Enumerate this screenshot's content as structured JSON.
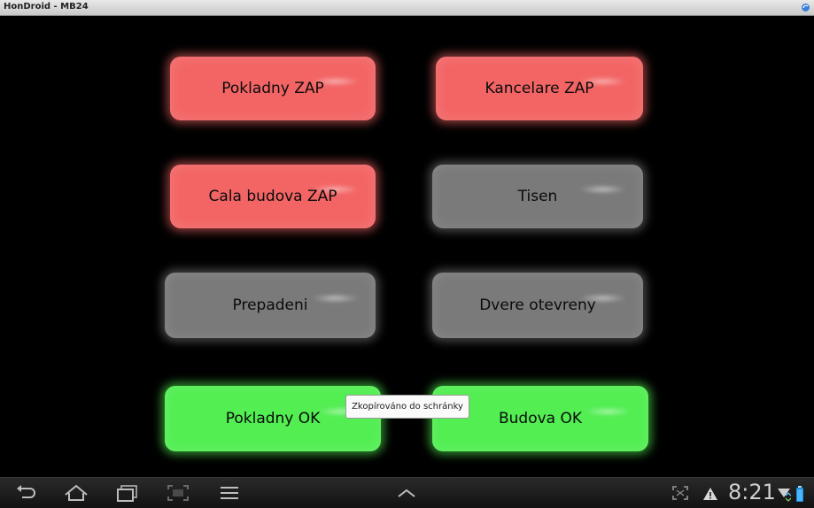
{
  "window": {
    "title": "HonDroid - MB24"
  },
  "buttons": [
    {
      "label": "Pokladny ZAP",
      "state": "red"
    },
    {
      "label": "Kancelare ZAP",
      "state": "red"
    },
    {
      "label": "Cala budova ZAP",
      "state": "red"
    },
    {
      "label": "Tisen",
      "state": "gray"
    },
    {
      "label": "Prepadeni",
      "state": "gray"
    },
    {
      "label": "Dvere otevreny",
      "state": "gray"
    },
    {
      "label": "Pokladny OK",
      "state": "green"
    },
    {
      "label": "Budova OK",
      "state": "green"
    }
  ],
  "toast": {
    "text": "Zkopírováno do schránky"
  },
  "statusbar": {
    "time": "8:21"
  },
  "colors": {
    "red": "#f36565",
    "gray": "#7a7a7a",
    "green": "#52ee52"
  },
  "icons": [
    "back-icon",
    "home-icon",
    "recent-apps-icon",
    "screenshot-icon",
    "menu-icon",
    "chevron-up-icon",
    "fullscreen-icon",
    "warning-icon",
    "signal-icon",
    "battery-icon",
    "rotate-icon"
  ]
}
